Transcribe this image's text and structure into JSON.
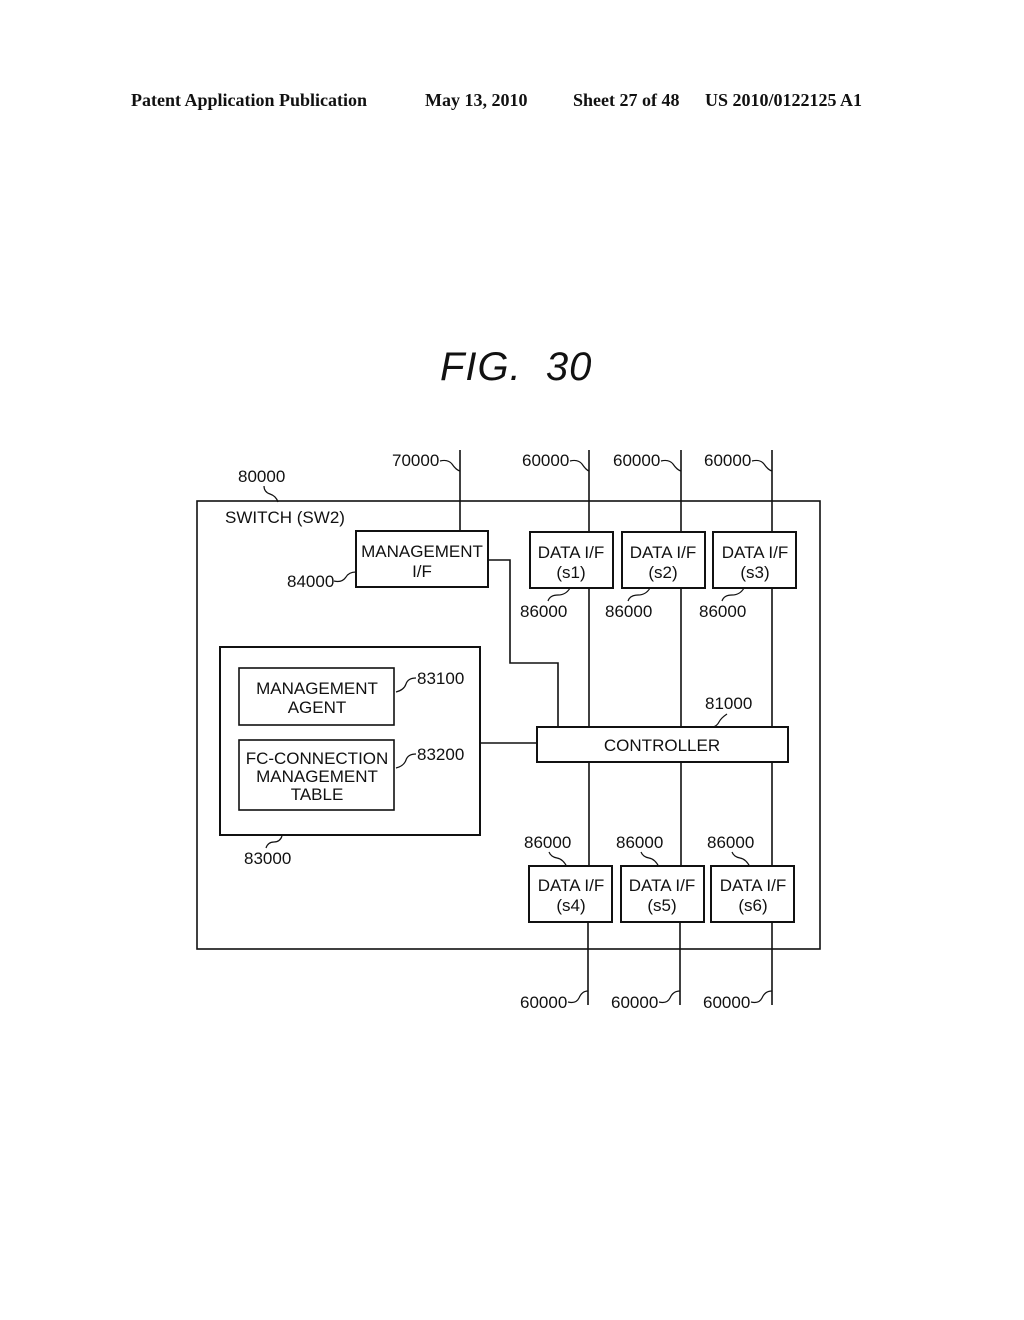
{
  "header": {
    "publication": "Patent Application Publication",
    "date": "May 13, 2010",
    "sheet": "Sheet 27 of 48",
    "number": "US 2010/0122125 A1"
  },
  "figure": {
    "title": "FIG. 30",
    "switch": {
      "ref": "80000",
      "label": "SWITCH (SW2)"
    },
    "management_if": {
      "ref": "84000",
      "line1": "MANAGEMENT",
      "line2": "I/F",
      "network_ref": "70000"
    },
    "data_ifs_top": [
      {
        "ref": "86000",
        "label": "DATA I/F",
        "id": "(s1)",
        "network_ref": "60000"
      },
      {
        "ref": "86000",
        "label": "DATA I/F",
        "id": "(s2)",
        "network_ref": "60000"
      },
      {
        "ref": "86000",
        "label": "DATA I/F",
        "id": "(s3)",
        "network_ref": "60000"
      }
    ],
    "data_ifs_bottom": [
      {
        "ref": "86000",
        "label": "DATA I/F",
        "id": "(s4)",
        "network_ref": "60000"
      },
      {
        "ref": "86000",
        "label": "DATA I/F",
        "id": "(s5)",
        "network_ref": "60000"
      },
      {
        "ref": "86000",
        "label": "DATA I/F",
        "id": "(s6)",
        "network_ref": "60000"
      }
    ],
    "controller": {
      "ref": "81000",
      "label": "CONTROLLER"
    },
    "memory": {
      "ref": "83000",
      "agent": {
        "ref": "83100",
        "line1": "MANAGEMENT",
        "line2": "AGENT"
      },
      "table": {
        "ref": "83200",
        "line1": "FC-CONNECTION",
        "line2": "MANAGEMENT",
        "line3": "TABLE"
      }
    }
  }
}
